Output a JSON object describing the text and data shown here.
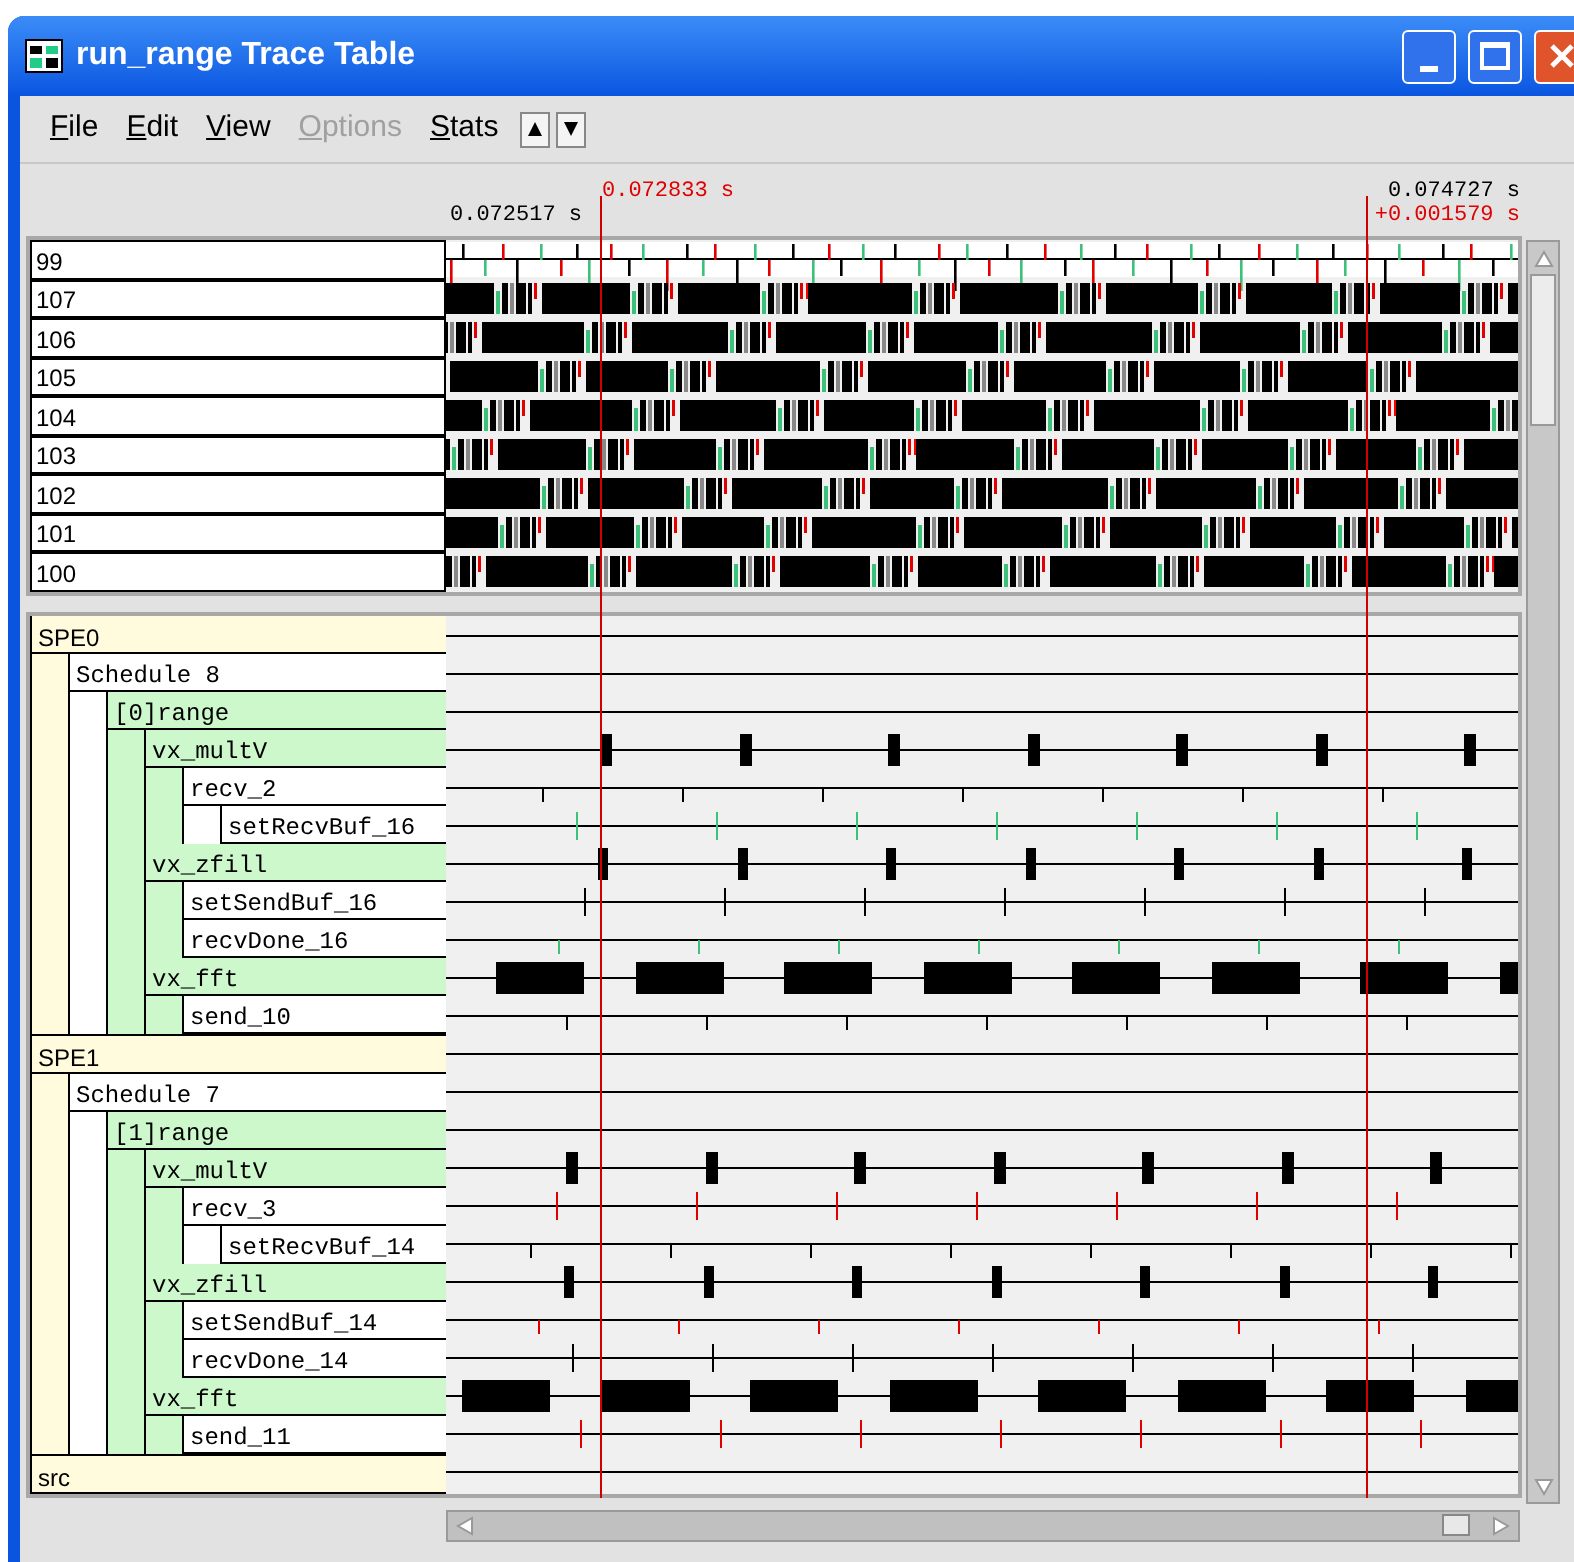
{
  "window": {
    "title": "run_range Trace Table"
  },
  "menu": [
    {
      "label": "File",
      "disabled": false
    },
    {
      "label": "Edit",
      "disabled": false
    },
    {
      "label": "View",
      "disabled": false
    },
    {
      "label": "Options",
      "disabled": true
    },
    {
      "label": "Stats",
      "disabled": false
    }
  ],
  "time_header": {
    "start": "0.072517 s",
    "cursor": "0.072833 s",
    "end": "0.074727 s",
    "delta": "+0.001579 s"
  },
  "processors": [
    {
      "label": "99"
    },
    {
      "label": "107"
    },
    {
      "label": "106"
    },
    {
      "label": "105"
    },
    {
      "label": "104"
    },
    {
      "label": "103"
    },
    {
      "label": "102"
    },
    {
      "label": "101"
    },
    {
      "label": "100"
    }
  ],
  "tree": [
    {
      "label": "SPE0",
      "kind": "processor",
      "children": [
        {
          "label": "Schedule 8",
          "kind": "schedule",
          "children": [
            {
              "label": "[0]range",
              "kind": "range",
              "children": [
                {
                  "label": "vx_multV",
                  "kind": "kernel",
                  "children": [
                    {
                      "label": "recv_2",
                      "kind": "call",
                      "children": [
                        {
                          "label": "setRecvBuf_16",
                          "kind": "call"
                        }
                      ]
                    }
                  ]
                },
                {
                  "label": "vx_zfill",
                  "kind": "kernel",
                  "children": [
                    {
                      "label": "setSendBuf_16",
                      "kind": "call"
                    },
                    {
                      "label": "recvDone_16",
                      "kind": "call"
                    }
                  ]
                },
                {
                  "label": "vx_fft",
                  "kind": "kernel",
                  "children": [
                    {
                      "label": "send_10",
                      "kind": "call"
                    }
                  ]
                }
              ]
            }
          ]
        }
      ]
    },
    {
      "label": "SPE1",
      "kind": "processor",
      "children": [
        {
          "label": "Schedule 7",
          "kind": "schedule",
          "children": [
            {
              "label": "[1]range",
              "kind": "range",
              "children": [
                {
                  "label": "vx_multV",
                  "kind": "kernel",
                  "children": [
                    {
                      "label": "recv_3",
                      "kind": "call",
                      "children": [
                        {
                          "label": "setRecvBuf_14",
                          "kind": "call"
                        }
                      ]
                    }
                  ]
                },
                {
                  "label": "vx_zfill",
                  "kind": "kernel",
                  "children": [
                    {
                      "label": "setSendBuf_14",
                      "kind": "call"
                    },
                    {
                      "label": "recvDone_14",
                      "kind": "call"
                    }
                  ]
                },
                {
                  "label": "vx_fft",
                  "kind": "kernel",
                  "children": [
                    {
                      "label": "send_11",
                      "kind": "call"
                    }
                  ]
                }
              ]
            }
          ]
        }
      ]
    },
    {
      "label": "src",
      "kind": "processor"
    }
  ]
}
